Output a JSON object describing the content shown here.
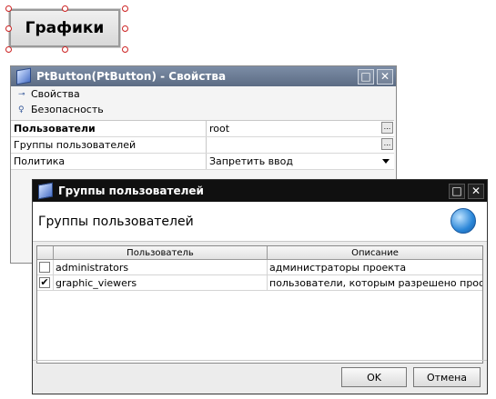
{
  "canvas": {
    "button_label": "Графики"
  },
  "properties_window": {
    "title": "PtButton(PtButton) - Свойства",
    "sections": [
      "Свойства",
      "Безопасность"
    ],
    "rows": [
      {
        "key": "Пользователи",
        "value": "root",
        "bold": true,
        "editor": "dots"
      },
      {
        "key": "Группы пользователей",
        "value": "",
        "editor": "dots"
      },
      {
        "key": "Политика",
        "value": "Запретить ввод",
        "editor": "dropdown"
      }
    ],
    "maximize_icon": "maximize-icon",
    "close_icon": "close-icon"
  },
  "groups_dialog": {
    "title": "Группы пользователей",
    "header": "Группы пользователей",
    "columns": [
      "Пользователь",
      "Описание"
    ],
    "rows": [
      {
        "checked": false,
        "user": "administrators",
        "description": "администраторы проекта"
      },
      {
        "checked": true,
        "user": "graphic_viewers",
        "description": "пользователи, которым разрешено прос..."
      }
    ],
    "ok_label": "OK",
    "cancel_label": "Отмена"
  }
}
